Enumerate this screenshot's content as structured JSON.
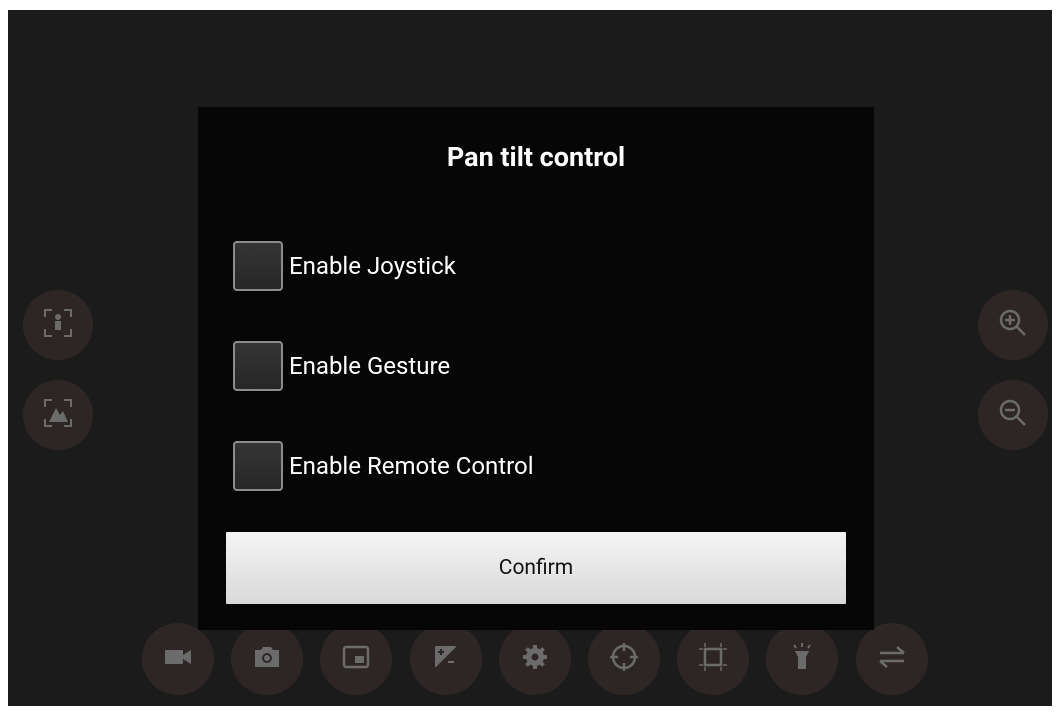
{
  "dialog": {
    "title": "Pan tilt control",
    "options": [
      {
        "label": "Enable Joystick",
        "checked": false
      },
      {
        "label": "Enable Gesture",
        "checked": false
      },
      {
        "label": "Enable Remote Control",
        "checked": false
      }
    ],
    "confirm_label": "Confirm"
  },
  "left_controls": [
    "face-tracking-icon",
    "scene-tracking-icon"
  ],
  "right_controls": [
    "zoom-in-icon",
    "zoom-out-icon"
  ],
  "bottom_toolbar": [
    "video-camera-icon",
    "photo-camera-icon",
    "picture-in-picture-icon",
    "exposure-icon",
    "settings-gear-icon",
    "target-crosshair-icon",
    "crop-frame-icon",
    "flashlight-icon",
    "swap-icon"
  ],
  "colors": {
    "background": "#1b1b1b",
    "dialog_background": "#060606",
    "control_button": "#2e2624",
    "icon": "#6b6b6b",
    "confirm_button": "#e6e6e6"
  }
}
